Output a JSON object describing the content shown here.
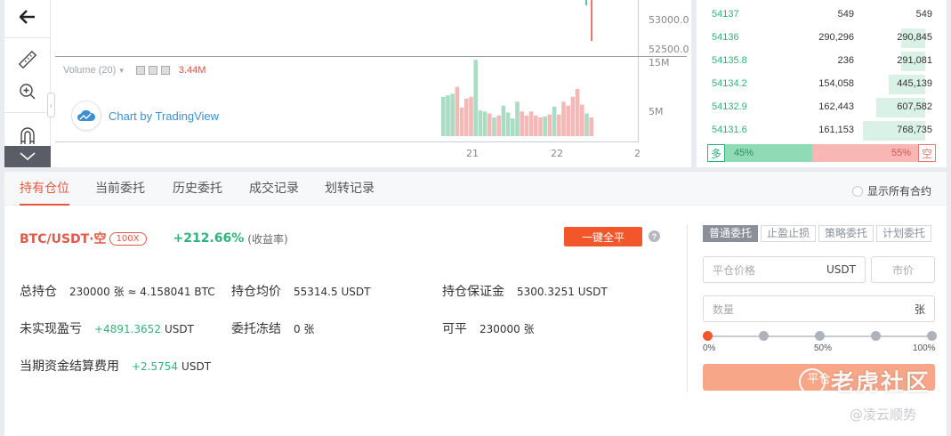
{
  "chart": {
    "price_ticks": [
      "53000.0",
      "52500.0"
    ],
    "volume_ticks": [
      "15M",
      "5M"
    ],
    "time_ticks": [
      "21",
      "22",
      "2"
    ],
    "volume_legend": {
      "label": "Volume (20)",
      "arrow": "▾",
      "value": "3.44M"
    },
    "branding": "Chart by TradingView",
    "colors": {
      "up": "#a9dcc3",
      "down": "#f4b9b6",
      "up_candle": "#2eb37a",
      "down_candle": "#e14b4b"
    }
  },
  "chart_data": {
    "type": "bar",
    "title": "",
    "xlabel": "",
    "ylabel": "",
    "ylim": [
      0,
      17000000
    ],
    "x_ticks": [
      "21",
      "22",
      "2"
    ],
    "y_ticks": [
      "15M",
      "5M"
    ],
    "bars": [
      {
        "v": 8.0,
        "up": true
      },
      {
        "v": 8.3,
        "up": true
      },
      {
        "v": 8.6,
        "up": true
      },
      {
        "v": 10.0,
        "up": false
      },
      {
        "v": 5.8,
        "up": false
      },
      {
        "v": 7.6,
        "up": false
      },
      {
        "v": 8.0,
        "up": false
      },
      {
        "v": 15.5,
        "up": true
      },
      {
        "v": 5.2,
        "up": true
      },
      {
        "v": 5.0,
        "up": true
      },
      {
        "v": 4.6,
        "up": false
      },
      {
        "v": 3.8,
        "up": true
      },
      {
        "v": 4.2,
        "up": false
      },
      {
        "v": 6.2,
        "up": true
      },
      {
        "v": 4.8,
        "up": true
      },
      {
        "v": 3.6,
        "up": true
      },
      {
        "v": 7.0,
        "up": true
      },
      {
        "v": 5.0,
        "up": false
      },
      {
        "v": 4.2,
        "up": false
      },
      {
        "v": 5.0,
        "up": false
      },
      {
        "v": 4.2,
        "up": false
      },
      {
        "v": 3.8,
        "up": false
      },
      {
        "v": 4.0,
        "up": true
      },
      {
        "v": 4.4,
        "up": false
      },
      {
        "v": 6.0,
        "up": true
      },
      {
        "v": 4.4,
        "up": false
      },
      {
        "v": 7.0,
        "up": false
      },
      {
        "v": 6.2,
        "up": false
      },
      {
        "v": 8.0,
        "up": false
      },
      {
        "v": 9.6,
        "up": false
      },
      {
        "v": 6.4,
        "up": false
      },
      {
        "v": 4.6,
        "up": true
      },
      {
        "v": 3.8,
        "up": false
      }
    ],
    "unit": "M"
  },
  "toolbar": {
    "back_icon": "arrow-left-icon",
    "ruler_icon": "ruler-icon",
    "zoom_icon": "zoom-in-icon",
    "magnet_icon": "magnet-icon",
    "collapse_icon": "chevron-down-icon"
  },
  "orderbook": {
    "rows": [
      {
        "price": "54137",
        "amount": "549",
        "total": "549",
        "depth": 0.0
      },
      {
        "price": "54136",
        "amount": "290,296",
        "total": "290,845",
        "depth": 0.38
      },
      {
        "price": "54135.8",
        "amount": "236",
        "total": "291,081",
        "depth": 0.38
      },
      {
        "price": "54134.2",
        "amount": "154,058",
        "total": "445,139",
        "depth": 0.58
      },
      {
        "price": "54132.9",
        "amount": "162,443",
        "total": "607,582",
        "depth": 0.79
      },
      {
        "price": "54131.6",
        "amount": "161,153",
        "total": "768,735",
        "depth": 1.0
      }
    ],
    "ratio": {
      "long_tag": "多",
      "long_pct": "45%",
      "short_pct": "55%",
      "short_tag": "空",
      "long_value": 45,
      "short_value": 55
    }
  },
  "tabs": [
    {
      "label": "持有仓位",
      "active": true
    },
    {
      "label": "当前委托",
      "active": false
    },
    {
      "label": "历史委托",
      "active": false
    },
    {
      "label": "成交记录",
      "active": false
    },
    {
      "label": "划转记录",
      "active": false
    }
  ],
  "show_all_label": "显示所有合约",
  "position": {
    "symbol": "BTC/USDT·空",
    "leverage": "100X",
    "pnl_pct": "+212.66%",
    "pnl_label": "(收益率)",
    "close_all_label": "一键全平",
    "help_icon": "?",
    "fields": {
      "total": {
        "label": "总持仓",
        "value": "230000 张 ≈ 4.158041 BTC"
      },
      "avg_price": {
        "label": "持仓均价",
        "value": "55314.5 USDT"
      },
      "margin": {
        "label": "持仓保证金",
        "value": "5300.3251 USDT"
      },
      "unrealized": {
        "label": "未实现盈亏",
        "value": "+4891.3652",
        "unit": "USDT"
      },
      "frozen": {
        "label": "委托冻结",
        "value": "0 张"
      },
      "closable": {
        "label": "可平",
        "value": "230000 张"
      },
      "funding": {
        "label": "当期资金结算费用",
        "value": "+2.5754",
        "unit": "USDT"
      }
    }
  },
  "order_form": {
    "types": [
      {
        "label": "普通委托",
        "active": true
      },
      {
        "label": "止盈止损",
        "active": false
      },
      {
        "label": "策略委托",
        "active": false
      },
      {
        "label": "计划委托",
        "active": false
      }
    ],
    "price_placeholder": "平仓价格",
    "price_unit": "USDT",
    "market_label": "市价",
    "qty_placeholder": "数量",
    "qty_unit": "张",
    "slider": {
      "value": 0,
      "labels": [
        "0%",
        "50%",
        "100%"
      ]
    },
    "submit_label": "平仓"
  },
  "watermarks": {
    "tiger": "老虎社区",
    "author": "@凌云顺势"
  }
}
